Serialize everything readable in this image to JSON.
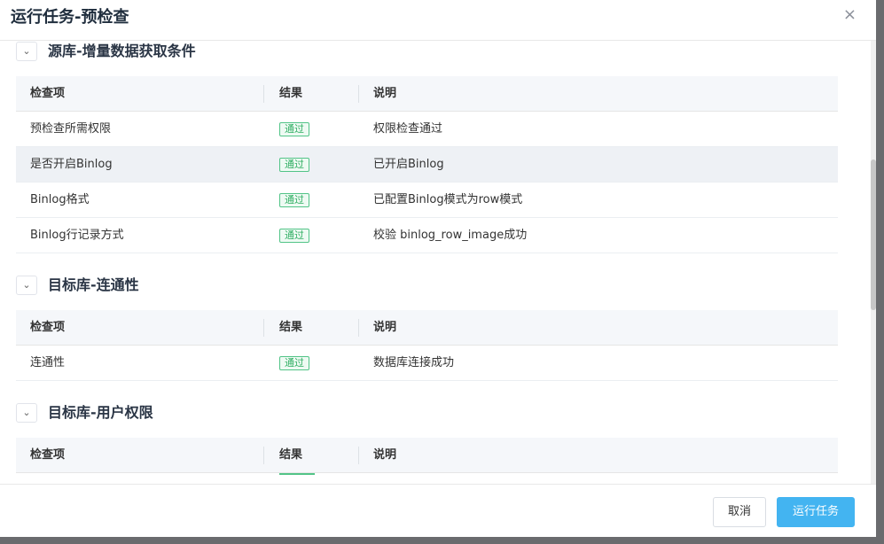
{
  "dialog": {
    "title": "运行任务-预检查",
    "close_icon": "×"
  },
  "sections": [
    {
      "title": "源库-增量数据获取条件",
      "toggle": "⌄",
      "columns": [
        "检查项",
        "结果",
        "说明"
      ],
      "rows": [
        {
          "item": "预检查所需权限",
          "result": "通过",
          "desc": "权限检查通过"
        },
        {
          "item": "是否开启Binlog",
          "result": "通过",
          "desc": "已开启Binlog"
        },
        {
          "item": "Binlog格式",
          "result": "通过",
          "desc": "已配置Binlog模式为row模式"
        },
        {
          "item": "Binlog行记录方式",
          "result": "通过",
          "desc": "校验 binlog_row_image成功"
        }
      ]
    },
    {
      "title": "目标库-连通性",
      "toggle": "⌄",
      "columns": [
        "检查项",
        "结果",
        "说明"
      ],
      "rows": [
        {
          "item": "连通性",
          "result": "通过",
          "desc": "数据库连接成功"
        }
      ]
    },
    {
      "title": "目标库-用户权限",
      "toggle": "⌄",
      "columns": [
        "检查项",
        "结果",
        "说明"
      ],
      "rows": []
    }
  ],
  "footer": {
    "cancel_label": "取消",
    "run_label": "运行任务"
  },
  "colors": {
    "success": "#2fae62",
    "primary": "#43b4f1"
  }
}
